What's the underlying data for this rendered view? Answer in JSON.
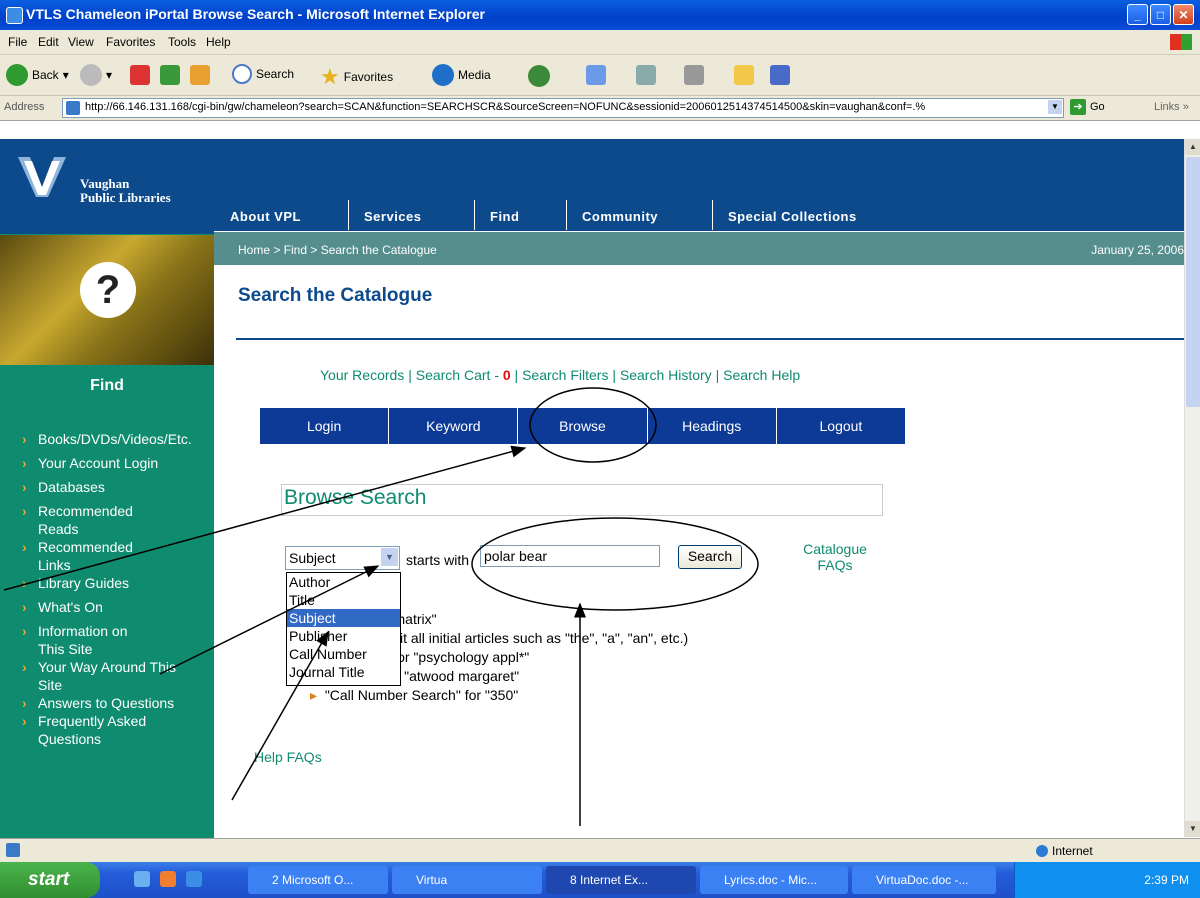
{
  "window": {
    "title": "VTLS Chameleon iPortal Browse Search - Microsoft Internet Explorer"
  },
  "menu": [
    "File",
    "Edit",
    "View",
    "Favorites",
    "Tools",
    "Help"
  ],
  "toolbar": {
    "back": "Back",
    "search": "Search",
    "favorites": "Favorites",
    "media": "Media"
  },
  "address": {
    "label": "Address",
    "url": "http://66.146.131.168/cgi-bin/gw/chameleon?search=SCAN&function=SEARCHSCR&SourceScreen=NOFUNC&sessionid=2006012514374514500&skin=vaughan&conf=.%",
    "go": "Go",
    "links": "Links"
  },
  "site": {
    "logo_line1": "Vaughan",
    "logo_line2": "Public Libraries",
    "nav": [
      "About VPL",
      "Services",
      "Find",
      "Community",
      "Special Collections"
    ],
    "breadcrumb": "Home > Find > Search the Catalogue",
    "date": "January 25, 2006",
    "page_title": "Search the Catalogue",
    "find_label": "Find"
  },
  "sidebar": [
    "Books/DVDs/Videos/Etc.",
    "Your Account Login",
    "Databases",
    "Recommended Reads",
    "Recommended Links",
    "Library Guides",
    "What's On",
    "Information on This Site",
    "Your Way Around This Site",
    "Answers to Questions",
    "Frequently Asked Questions"
  ],
  "toplinks": {
    "records": "Your Records",
    "cart": "Search Cart -",
    "cart_count": "0",
    "filters": "Search Filters",
    "history": "Search History",
    "help": "Search Help"
  },
  "tabs": [
    "Login",
    "Keyword",
    "Browse",
    "Headings",
    "Logout"
  ],
  "browse": {
    "title": "Browse Search",
    "selected": "Subject",
    "starts_with": "starts with",
    "query": "polar bear",
    "search_button": "Search",
    "catalogue_faqs": "Catalogue FAQs",
    "options": [
      "Author",
      "Title",
      "Subject",
      "Publisher",
      "Call Number",
      "Journal Title"
    ]
  },
  "tips": [
    "rch\" for \"matrix\"",
    "it all initial articles such as \"the\", \"a\", \"an\", etc.)",
    "Search\" for \"psychology appl*\"",
    "earch\" for \"atwood margaret\"",
    "\"Call Number Search\" for \"350\""
  ],
  "help_faqs": "Help FAQs",
  "status": {
    "zone": "Internet"
  },
  "taskbar": {
    "start": "start",
    "tasks": [
      "2 Microsoft O...",
      "Virtua",
      "8 Internet Ex...",
      "Lyrics.doc - Mic...",
      "VirtuaDoc.doc -..."
    ],
    "clock": "2:39 PM"
  },
  "colors": {
    "navy": "#0c4a8c",
    "teal": "#0f8b6f",
    "tab_blue": "#0c3a96"
  }
}
